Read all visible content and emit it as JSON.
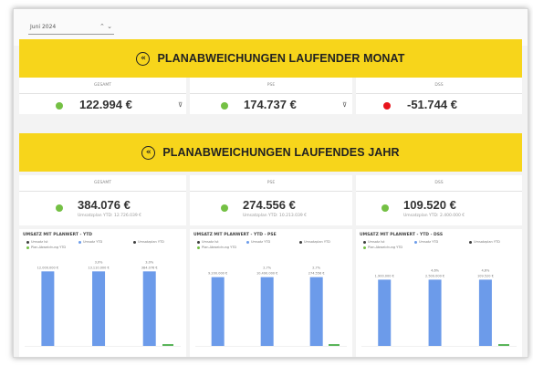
{
  "filter": {
    "value": "Juni 2024",
    "arrows": "⌃ ⌄"
  },
  "banners": {
    "month": {
      "icon": "«",
      "title": "PLANABWEICHUNGEN LAUFENDER MONAT"
    },
    "year": {
      "icon": "«",
      "title": "PLANABWEICHUNGEN LAUFENDES JAHR"
    }
  },
  "month_cards": [
    {
      "label": "GESAMT",
      "value": "122.994 €",
      "status": "green",
      "filter_icon": "⊽"
    },
    {
      "label": "PSE",
      "value": "174.737 €",
      "status": "green",
      "filter_icon": "⊽"
    },
    {
      "label": "DSS",
      "value": "-51.744 €",
      "status": "red",
      "filter_icon": ""
    }
  ],
  "year_cards": [
    {
      "label": "GESAMT",
      "value": "384.076 €",
      "status": "green",
      "sub": "Umsatzplan YTD: 12.726.039 €"
    },
    {
      "label": "PSE",
      "value": "274.556 €",
      "status": "green",
      "sub": "Umsatzplan YTD: 10.213.039 €"
    },
    {
      "label": "DSS",
      "value": "109.520 €",
      "status": "green",
      "sub": "Umsatzplan YTD: 2.400.000 €"
    }
  ],
  "colors": {
    "green": "#74c044",
    "red": "#e8141c",
    "yellow": "#f7d51b",
    "bar": "#6c9bea",
    "dark": "#3d3d3d",
    "line": "#5ab55a"
  },
  "chart_data": [
    {
      "type": "bar",
      "title": "UMSATZ MIT PLANWERT - YTD",
      "legend": [
        "Umsatz Ist",
        "Umsatz YTD",
        "Umsatzplan YTD",
        "Plan-Abweichung YTD"
      ],
      "categories": [
        "",
        "",
        ""
      ],
      "values": [
        100,
        100,
        100
      ],
      "labels": [
        "12.000.000 €",
        "13.110.000 €",
        "384.076 €"
      ],
      "pct": "3,0%",
      "ylim": [
        0,
        120
      ]
    },
    {
      "type": "bar",
      "title": "UMSATZ MIT PLANWERT - YTD - PSE",
      "legend": [
        "Umsatz Ist",
        "Umsatz YTD",
        "Umsatzplan YTD",
        "Plan-Abweichung YTD"
      ],
      "categories": [
        "",
        "",
        ""
      ],
      "values": [
        100,
        100,
        100
      ],
      "labels": [
        "9.200.000 €",
        "10.490.000 €",
        "274.556 €"
      ],
      "pct": "2,7%",
      "ylim": [
        0,
        130
      ]
    },
    {
      "type": "bar",
      "title": "UMSATZ MIT PLANWERT - YTD - DSS",
      "legend": [
        "Umsatz Ist",
        "Umsatz YTD",
        "Umsatzplan YTD",
        "Plan-Abweichung YTD"
      ],
      "categories": [
        "",
        "",
        ""
      ],
      "values": [
        100,
        100,
        100
      ],
      "labels": [
        "1.900.000 €",
        "2.509.000 €",
        "109.520 €"
      ],
      "pct": "4,6%",
      "ylim": [
        0,
        135
      ]
    }
  ]
}
